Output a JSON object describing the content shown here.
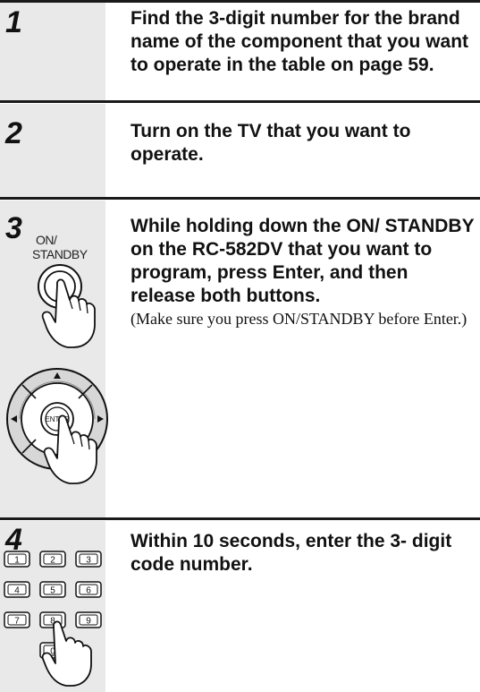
{
  "steps": [
    {
      "number": "1",
      "instruction": "Find the 3-digit number for the brand name of the component that you want to operate in the table on page 59."
    },
    {
      "number": "2",
      "instruction": "Turn on the TV that you want to operate."
    },
    {
      "number": "3",
      "instruction": "While holding down the ON/ STANDBY on the RC-582DV that you want to program, press Enter, and then release both buttons.",
      "note": "(Make sure you press ON/STANDBY before Enter.)",
      "illustration": {
        "button_label_line1": "ON/",
        "button_label_line2": "STANDBY",
        "enter_label": "ENTER",
        "icons": [
          "power-button-icon",
          "pointing-hand-icon",
          "navigation-pad-icon"
        ]
      }
    },
    {
      "number": "4",
      "instruction": "Within 10 seconds, enter the 3- digit code number.",
      "illustration": {
        "keys": [
          "1",
          "2",
          "3",
          "4",
          "5",
          "6",
          "7",
          "8",
          "9",
          "0"
        ],
        "icons": [
          "number-keypad-icon",
          "pointing-hand-icon"
        ]
      }
    }
  ]
}
